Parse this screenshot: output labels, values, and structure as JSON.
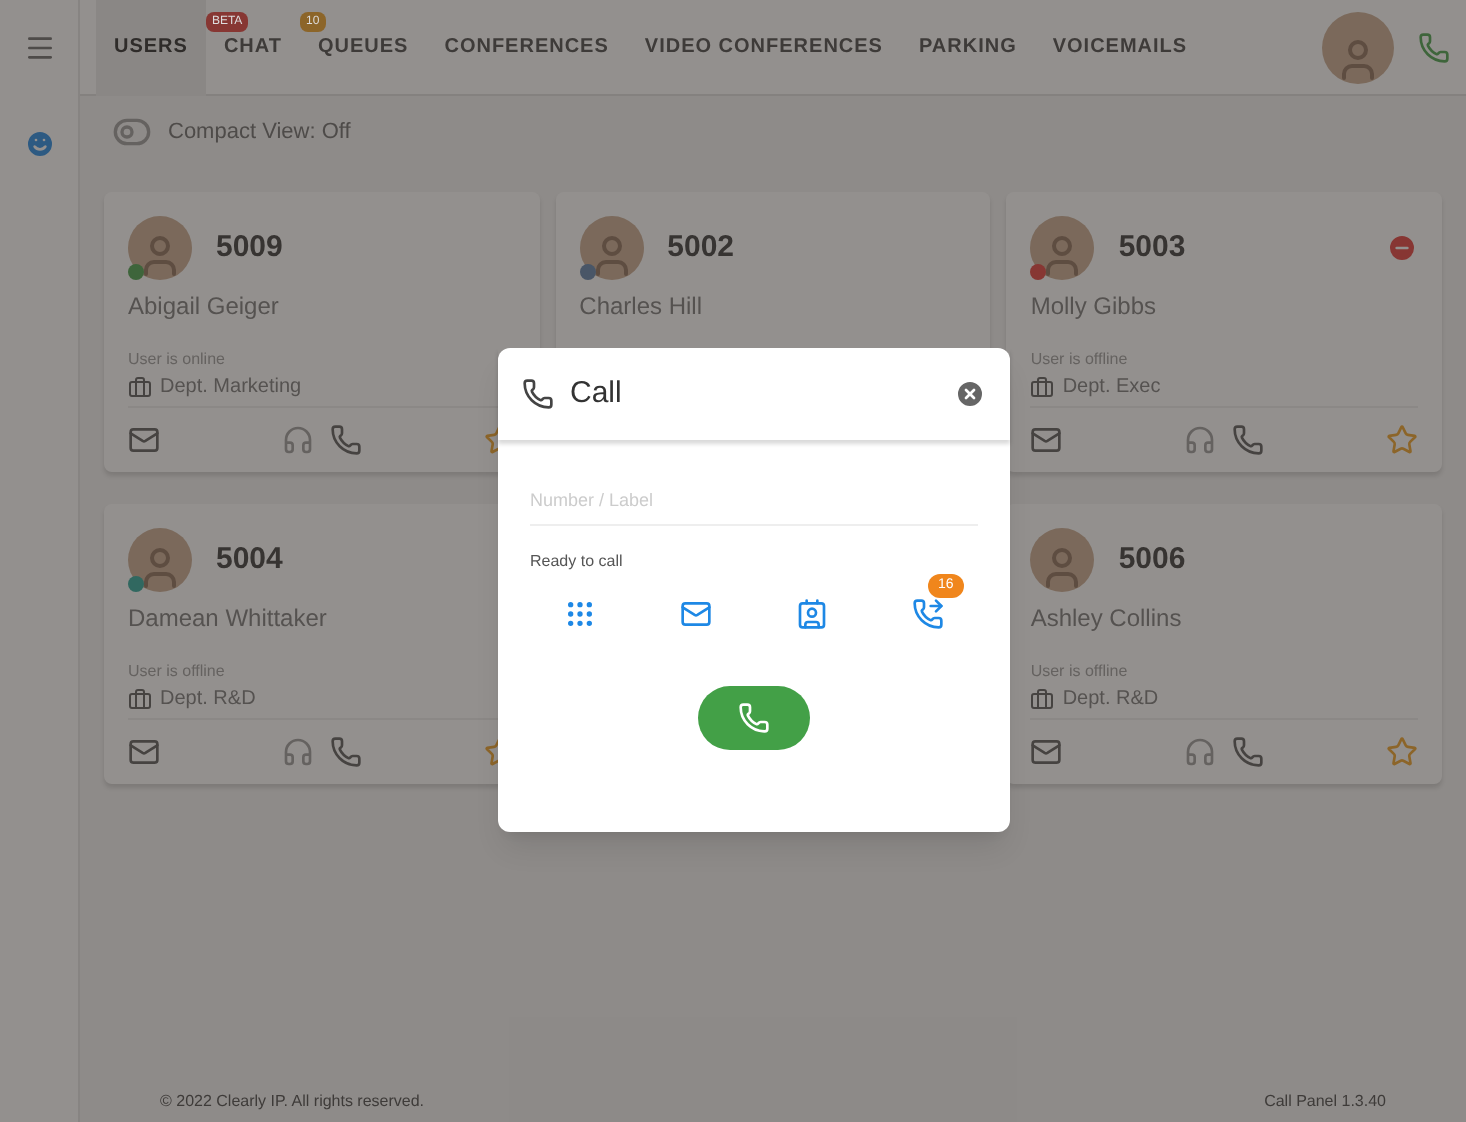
{
  "nav": {
    "tabs": [
      {
        "label": "USERS",
        "selected": true
      },
      {
        "label": "CHAT",
        "selected": false,
        "badge": {
          "text": "BETA",
          "color": "#873733"
        }
      },
      {
        "label": "QUEUES",
        "selected": false,
        "badge": {
          "text": "10",
          "color": "#8c6529"
        }
      },
      {
        "label": "CONFERENCES",
        "selected": false
      },
      {
        "label": "VIDEO CONFERENCES",
        "selected": false
      },
      {
        "label": "PARKING",
        "selected": false
      },
      {
        "label": "VOICEMAILS",
        "selected": false
      }
    ]
  },
  "compact_view": {
    "label": "Compact View: Off",
    "on": false
  },
  "users": [
    {
      "extension": "5009",
      "name": "Abigail Geiger",
      "color": "#3e653b",
      "status_text": "User is online",
      "department": "Dept. Marketing",
      "dnd": false
    },
    {
      "extension": "5002",
      "name": "Charles Hill",
      "color": "#495667",
      "dnd": false
    },
    {
      "extension": "5003",
      "name": "Molly Gibbs",
      "color": "#873733",
      "status_text": "User is offline",
      "department": "Dept. Exec",
      "dnd": true
    },
    {
      "extension": "5004",
      "name": "Damean Whittaker",
      "color": "#316860",
      "status_text": "User is offline",
      "department": "Dept. R&D",
      "dnd": false
    },
    {
      "extension": "5006",
      "name": "Ashley Collins",
      "status_text": "User is offline",
      "department": "Dept. R&D",
      "dnd": false
    }
  ],
  "dialog": {
    "title": "Call",
    "placeholder": "Number / Label",
    "status": "Ready to call",
    "history_badge": "16"
  },
  "footer": {
    "copyright": "© 2022 Clearly IP. All rights reserved.",
    "version": "Call Panel 1.3.40"
  }
}
